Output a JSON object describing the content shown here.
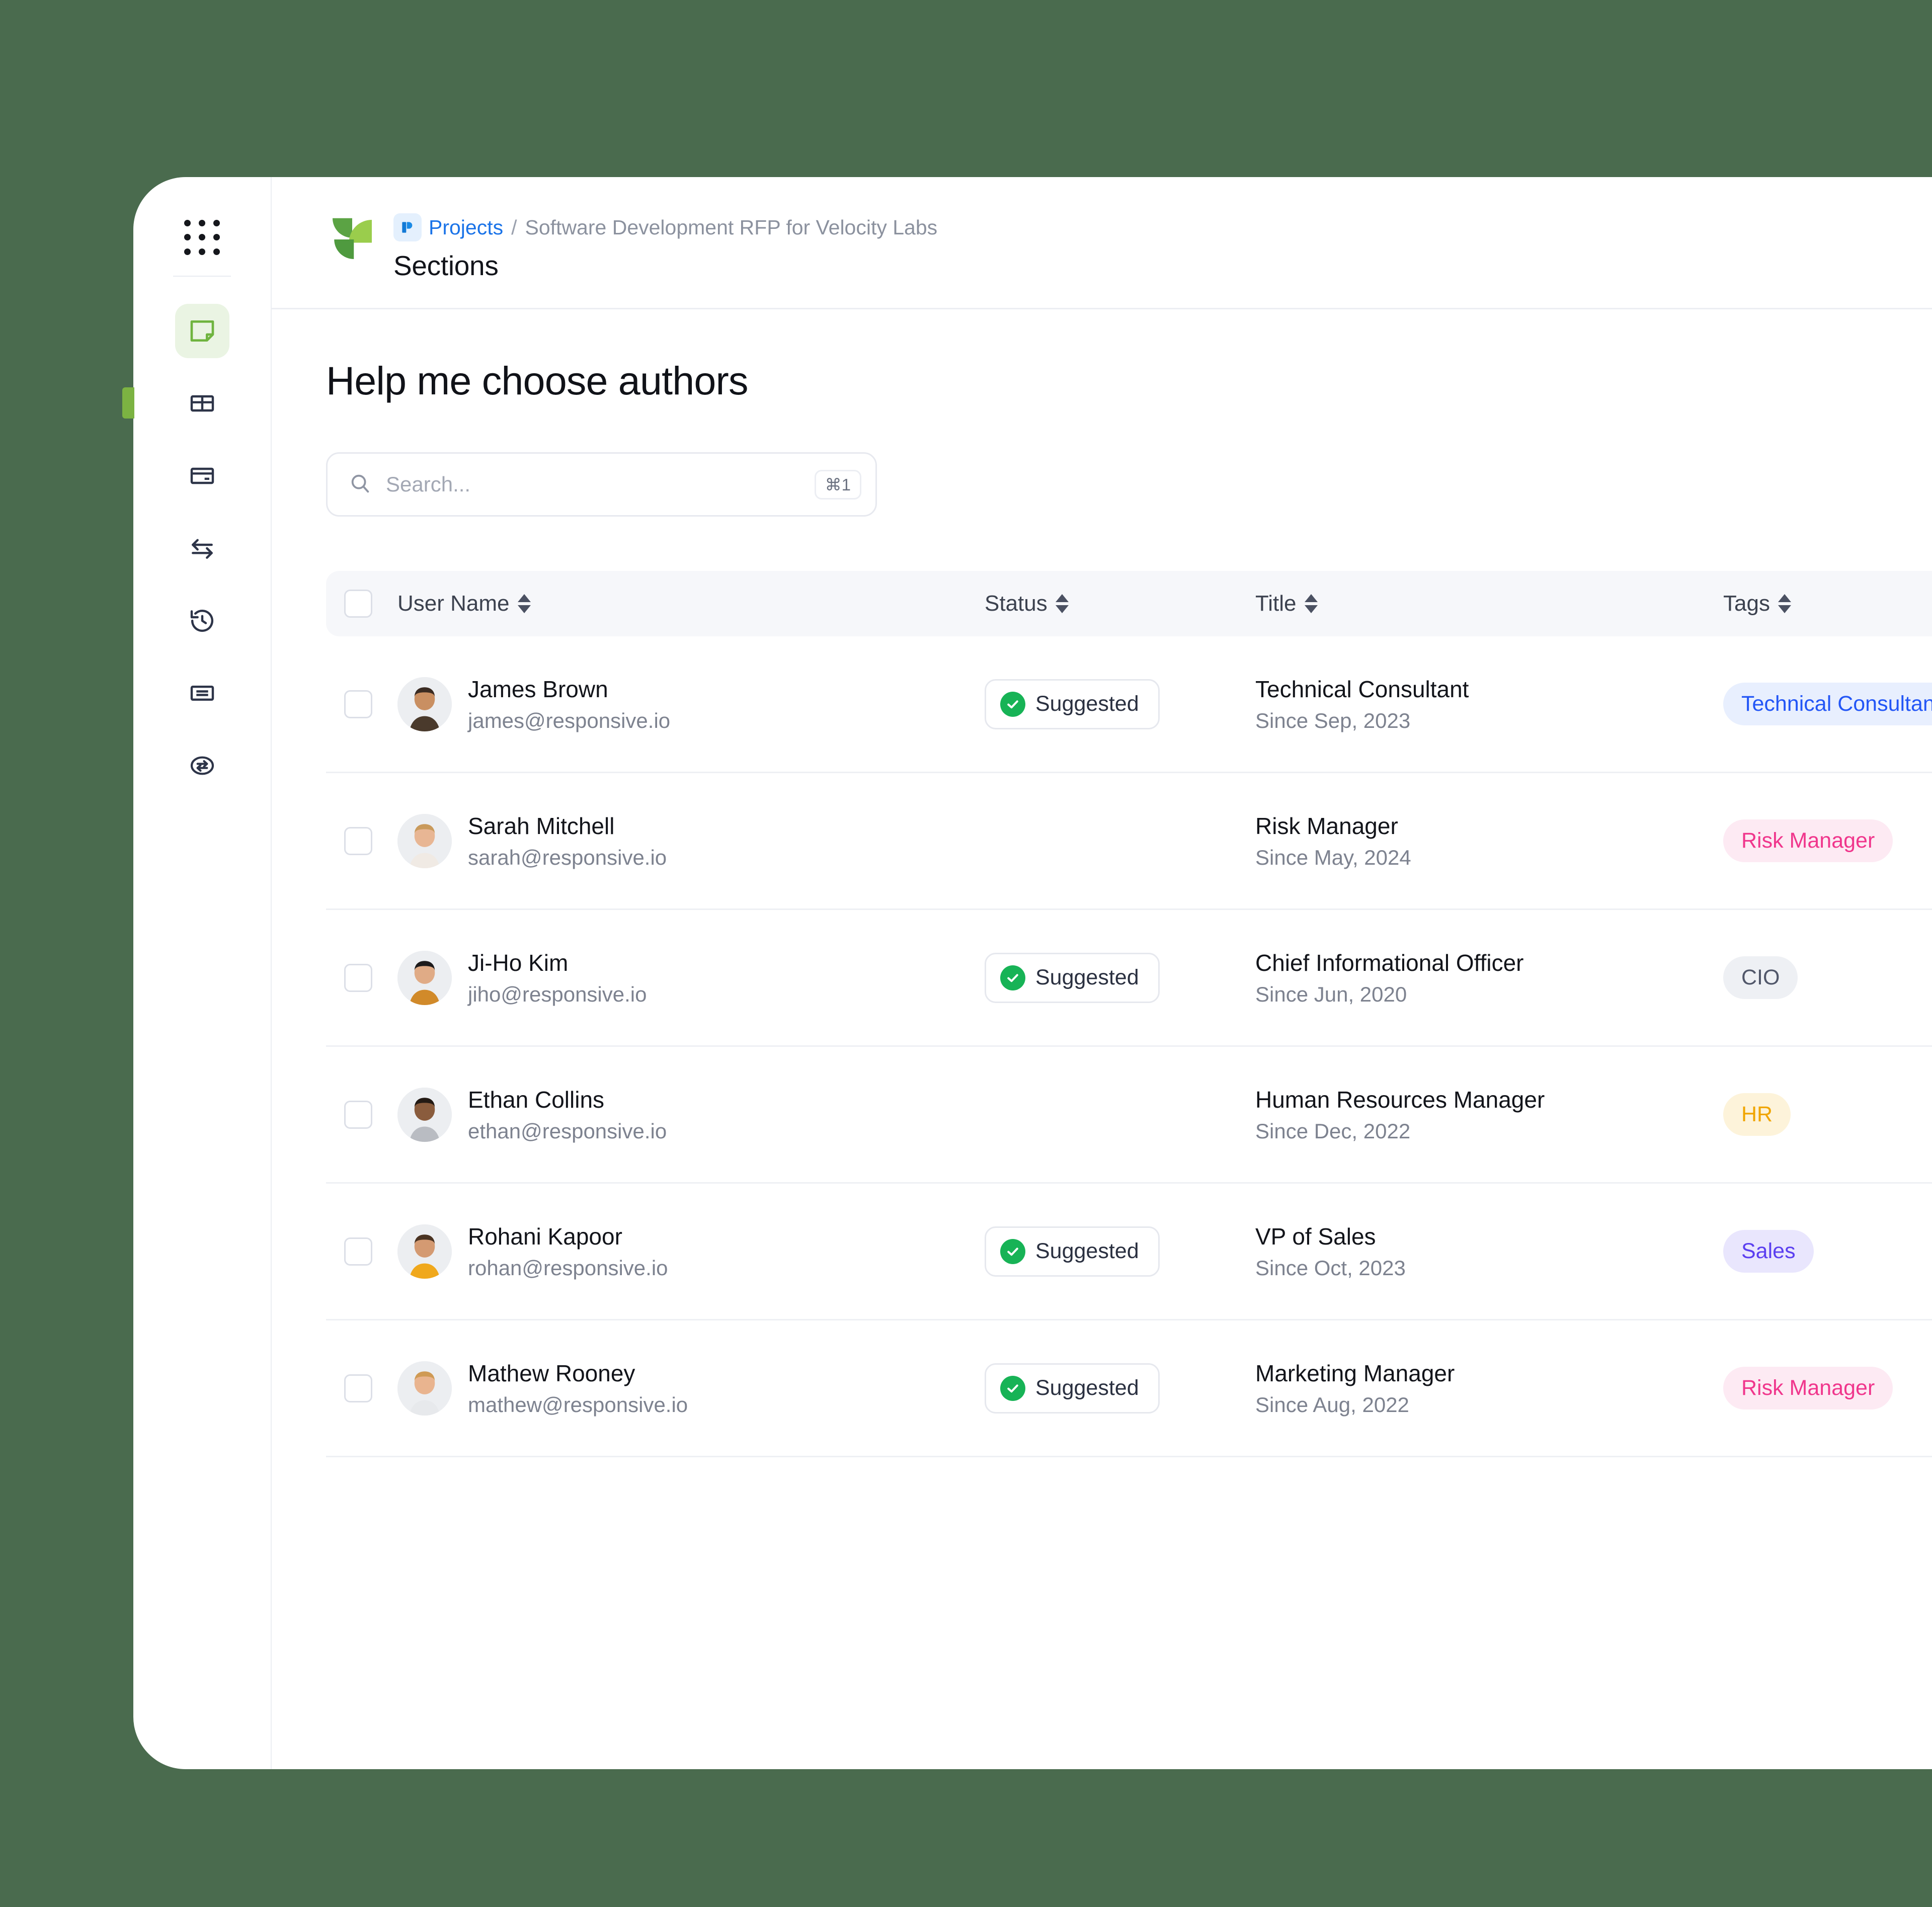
{
  "theme": {
    "page_background": "#4a6b4e",
    "accent_green": "#7cb342",
    "link_blue": "#1a73e8",
    "status_green": "#17b356"
  },
  "rail": {
    "apps_icon": "grid-dots-icon",
    "items": [
      {
        "icon": "note-icon",
        "name": "sections",
        "active": true
      },
      {
        "icon": "table-icon",
        "name": "table",
        "active": false
      },
      {
        "icon": "card-icon",
        "name": "card",
        "active": false
      },
      {
        "icon": "swap-icon",
        "name": "swap",
        "active": false
      },
      {
        "icon": "history-icon",
        "name": "history",
        "active": false
      },
      {
        "icon": "document-icon",
        "name": "document",
        "active": false
      },
      {
        "icon": "transfer-icon",
        "name": "transfer",
        "active": false
      }
    ]
  },
  "header": {
    "logo_icon": "leaf-logo",
    "projects_icon": "projects-app-icon",
    "breadcrumb_link": "Projects",
    "breadcrumb_separator": "/",
    "breadcrumb_current": "Software Development RFP for Velocity Labs",
    "page_title": "Sections"
  },
  "main": {
    "heading": "Help me choose authors",
    "search": {
      "placeholder": "Search...",
      "value": "",
      "shortcut": "⌘1",
      "icon": "search-icon"
    },
    "table": {
      "columns": [
        {
          "label": "User Name",
          "sortable": true
        },
        {
          "label": "Status",
          "sortable": true
        },
        {
          "label": "Title",
          "sortable": true
        },
        {
          "label": "Tags",
          "sortable": true
        }
      ],
      "select_all_checked": false,
      "rows": [
        {
          "checked": false,
          "avatar": "avatar-james",
          "name": "James Brown",
          "email": "james@responsive.io",
          "status": "Suggested",
          "title": "Technical Consultant",
          "since": "Since Sep, 2023",
          "tag": "Technical Consultant",
          "tag_color": "blue"
        },
        {
          "checked": false,
          "avatar": "avatar-sarah",
          "name": "Sarah Mitchell",
          "email": "sarah@responsive.io",
          "status": "",
          "title": "Risk Manager",
          "since": "Since May, 2024",
          "tag": "Risk Manager",
          "tag_color": "pink"
        },
        {
          "checked": false,
          "avatar": "avatar-jiho",
          "name": "Ji-Ho Kim",
          "email": "jiho@responsive.io",
          "status": "Suggested",
          "title": "Chief Informational Officer",
          "since": "Since Jun, 2020",
          "tag": "CIO",
          "tag_color": "gray"
        },
        {
          "checked": false,
          "avatar": "avatar-ethan",
          "name": "Ethan Collins",
          "email": "ethan@responsive.io",
          "status": "",
          "title": "Human Resources Manager",
          "since": "Since Dec, 2022",
          "tag": "HR",
          "tag_color": "amber"
        },
        {
          "checked": false,
          "avatar": "avatar-rohani",
          "name": "Rohani Kapoor",
          "email": "rohan@responsive.io",
          "status": "Suggested",
          "title": "VP of Sales",
          "since": "Since Oct, 2023",
          "tag": "Sales",
          "tag_color": "purple"
        },
        {
          "checked": false,
          "avatar": "avatar-mathew",
          "name": "Mathew Rooney",
          "email": "mathew@responsive.io",
          "status": "Suggested",
          "title": "Marketing Manager",
          "since": "Since Aug, 2022",
          "tag": "Risk Manager",
          "tag_color": "pink"
        }
      ]
    }
  }
}
